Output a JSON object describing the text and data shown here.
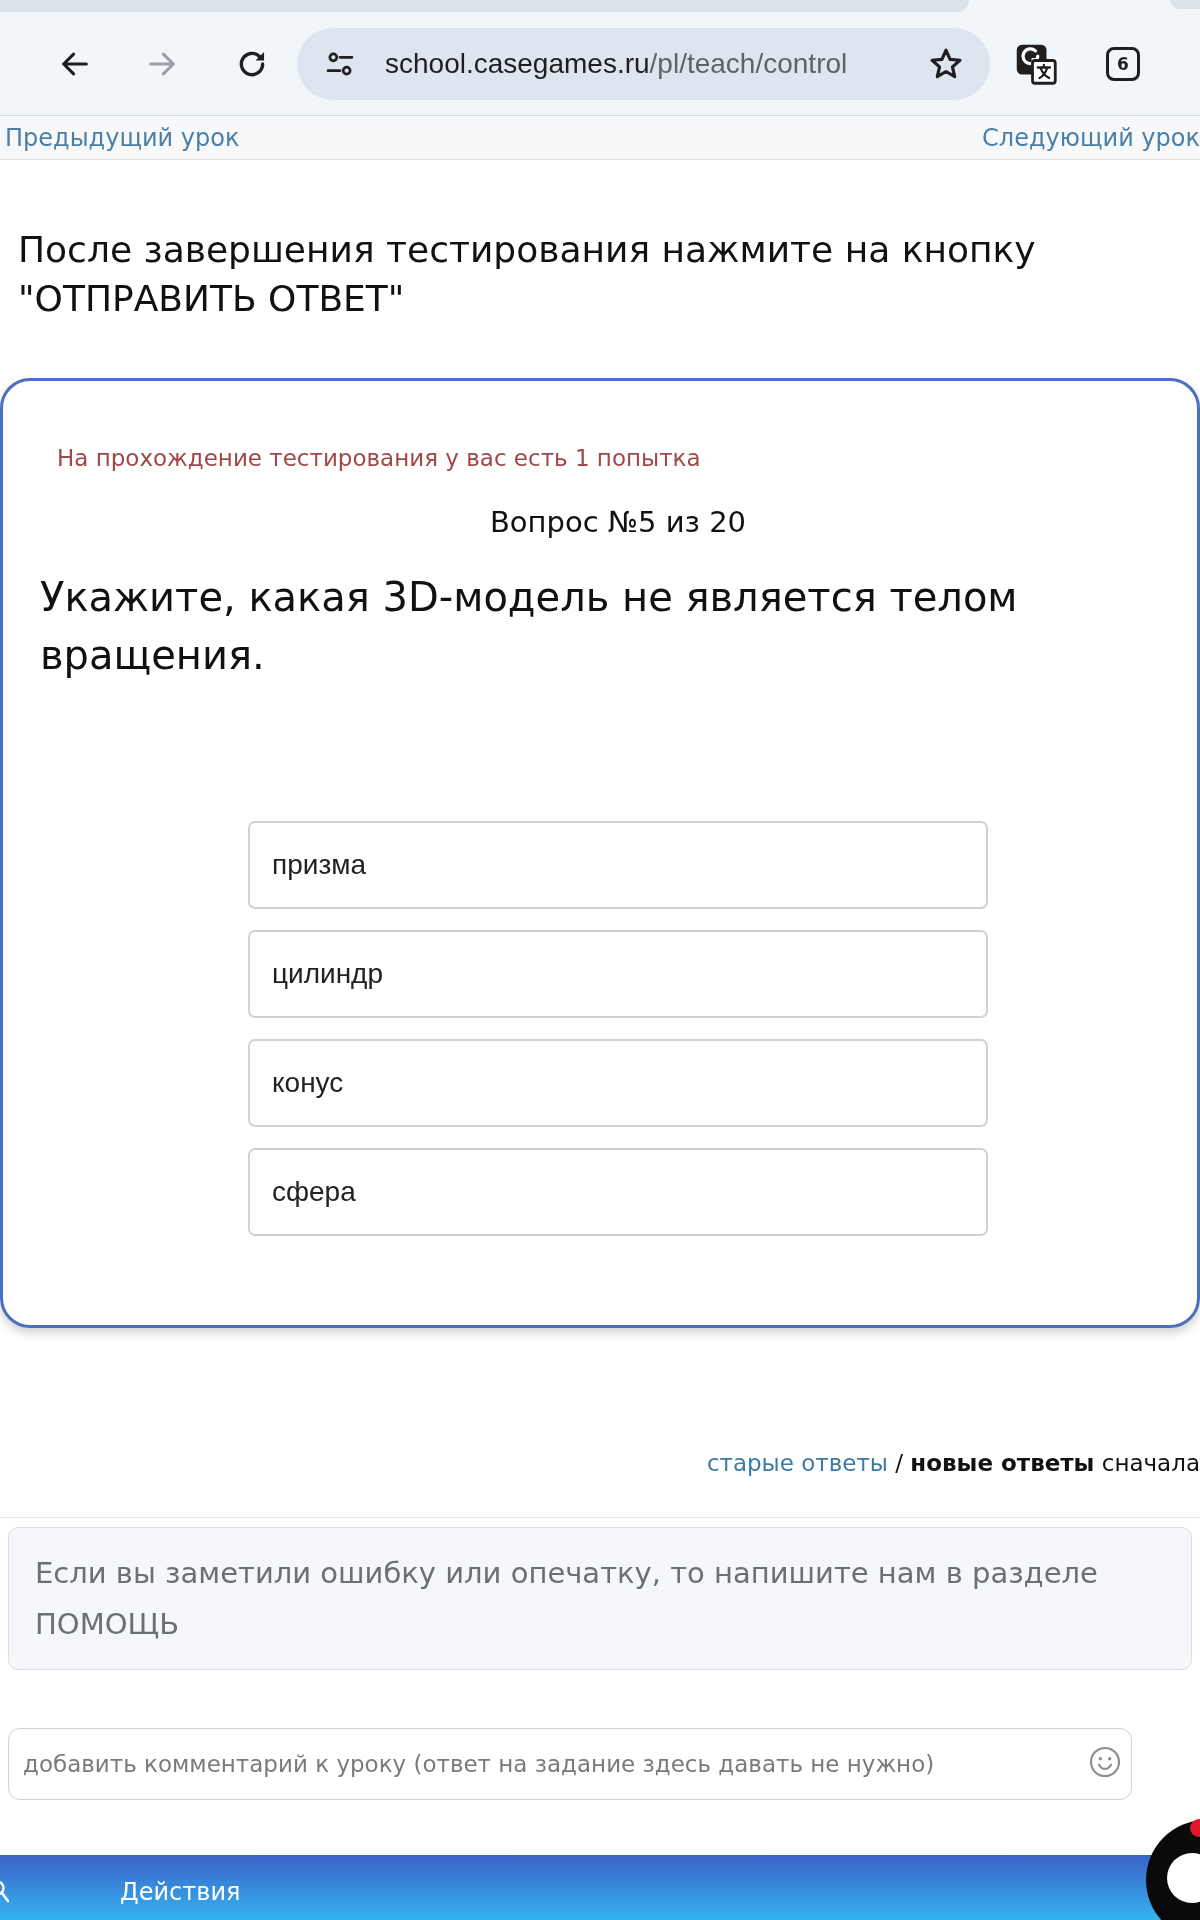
{
  "browser": {
    "forward_disabled": true,
    "url_host": "school.casegames.ru",
    "url_path": "/pl/teach/control",
    "tab_count": "6"
  },
  "lesson_nav": {
    "previous": "Предыдущий урок",
    "next": "Следующий урок"
  },
  "instruction": "После завершения тестирования нажмите на кнопку \"ОТПРАВИТЬ ОТВЕТ\"",
  "quiz": {
    "attempts_note": "На прохождение тестирования у вас есть 1 попытка",
    "progress": "Вопрос №5 из 20",
    "question": "Укажите, какая 3D-модель не является телом вращения.",
    "options": [
      {
        "label": "призма",
        "selected": false
      },
      {
        "label": "цилиндр",
        "selected": false
      },
      {
        "label": "конус",
        "selected": false
      },
      {
        "label": "сфера",
        "selected": false
      }
    ]
  },
  "answers_sort": {
    "options": [
      {
        "label": "старые ответы",
        "selected": false
      },
      {
        "label": "новые ответы",
        "selected": true
      }
    ],
    "separator": "/",
    "suffix": "сначала"
  },
  "notice": "Если вы заметили ошибку или опечатку, то напишите нам в разделе ПОМОЩЬ",
  "comment": {
    "placeholder": "добавить комментарий к уроку (ответ на задание здесь давать не нужно)"
  },
  "bottom_bar": {
    "label": "Действия"
  }
}
